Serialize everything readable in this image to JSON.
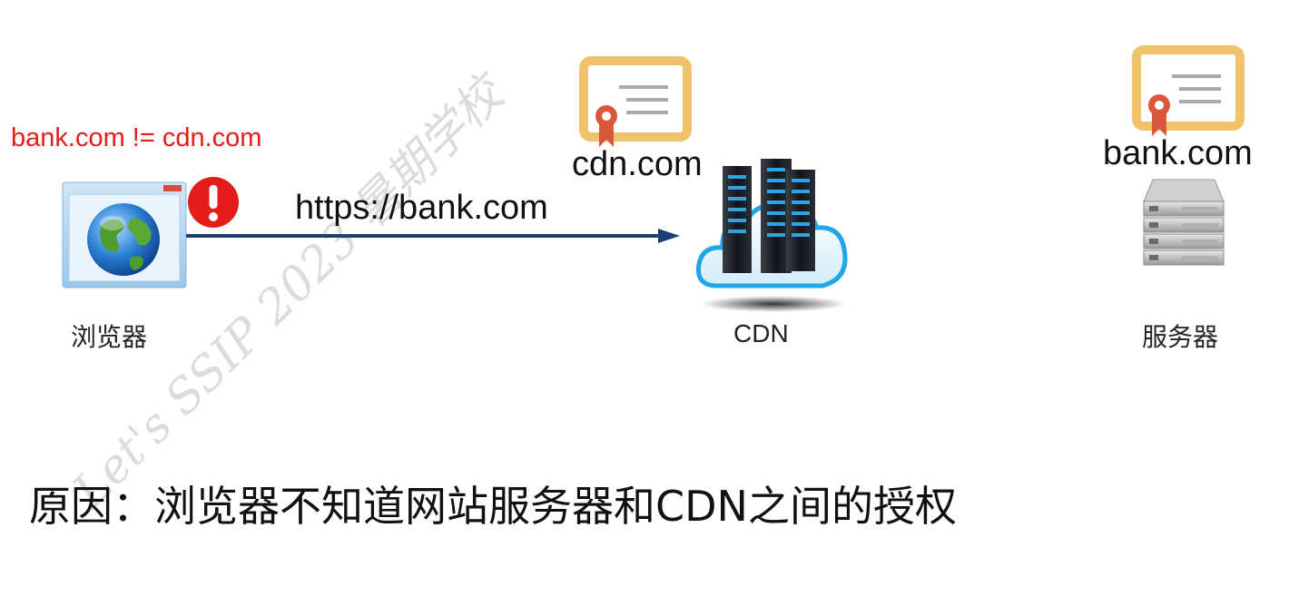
{
  "mismatch_text": "bank.com != cdn.com",
  "url_label": "https://bank.com",
  "cdn_cert_domain": "cdn.com",
  "server_cert_domain": "bank.com",
  "nodes": {
    "browser": "浏览器",
    "cdn": "CDN",
    "server": "服务器"
  },
  "conclusion": "原因：浏览器不知道网站服务器和CDN之间的授权",
  "watermark": "Let's SSIP 2023 暑期学校",
  "colors": {
    "alert_red": "#e31d1a",
    "arrow_blue": "#1f3f73",
    "cert_gold": "#f0c36a",
    "seal_red": "#d9573a"
  }
}
